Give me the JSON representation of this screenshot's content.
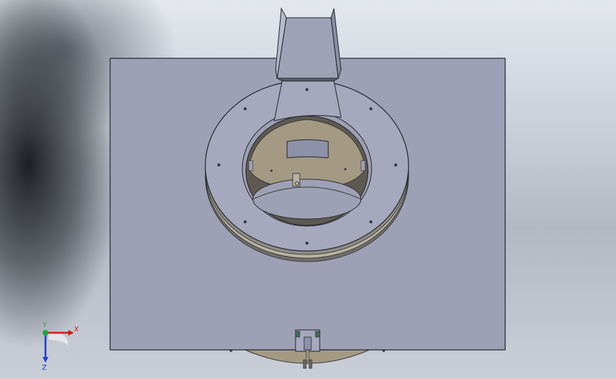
{
  "viewport": {
    "colors": {
      "plate": "#9ea0b6",
      "plate_edge": "#20222a",
      "flange": "#a6a9bd",
      "bore_wall": "#a49a83",
      "bore_dark": "#5e5a52",
      "chute": "#9fa2b7",
      "bolt": "#3a3b45"
    }
  },
  "triad": {
    "x_label": "X",
    "y_label": "Y",
    "z_label": "Z",
    "x_color": "#d11a1a",
    "y_color": "#1fa83a",
    "z_color": "#1c3ed0"
  }
}
